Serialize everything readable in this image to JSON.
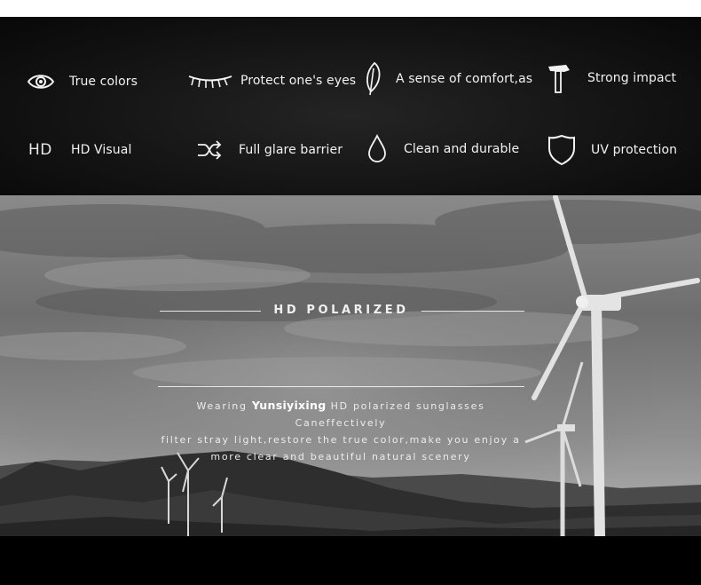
{
  "features": [
    {
      "icon": "eye-icon",
      "label": "True colors"
    },
    {
      "icon": "eyelash-icon",
      "label": "Protect one's eyes"
    },
    {
      "icon": "feather-icon",
      "label": "A sense of comfort,as"
    },
    {
      "icon": "hammer-icon",
      "label": "Strong impact"
    },
    {
      "icon": "hd-icon",
      "icon_text": "HD",
      "label": "HD Visual"
    },
    {
      "icon": "shuffle-icon",
      "label": "Full glare barrier"
    },
    {
      "icon": "droplet-icon",
      "label": "Clean and durable"
    },
    {
      "icon": "shield-icon",
      "label": "UV protection"
    }
  ],
  "banner": {
    "title": "HD POLARIZED",
    "desc_prefix": "Wearing ",
    "brand": "Yunsiyixing",
    "desc_line1_rest": " HD polarized sunglasses Caneffectively",
    "desc_line2": "filter stray light,restore the true color,make you enjoy a",
    "desc_line3": "more clear and beautiful natural scenery"
  },
  "colors": {
    "feature_bg": "#141414",
    "text": "#f2f2f2",
    "bottom_bar": "#000000"
  }
}
